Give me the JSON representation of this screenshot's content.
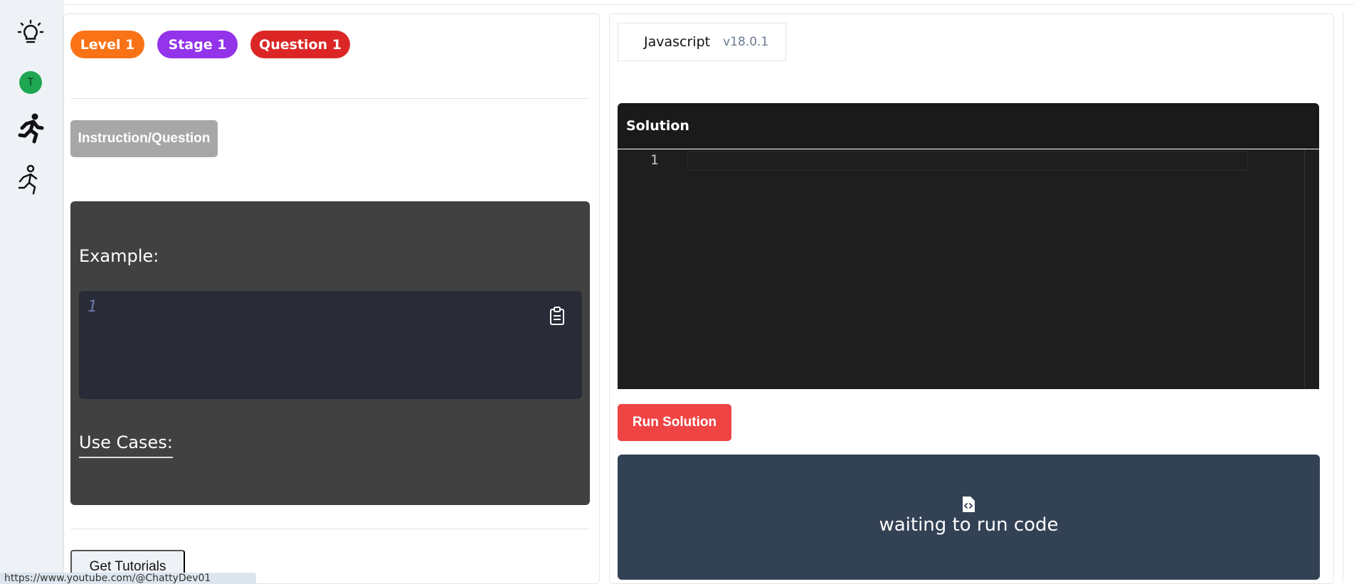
{
  "sidebar": {
    "icons": [
      "lightbulb-icon",
      "avatar",
      "running-person-icon",
      "jogging-person-icon"
    ],
    "avatar_initial": "T",
    "avatar_color": "#1fa653"
  },
  "badges": [
    {
      "label": "Level 1",
      "color": "#f97316"
    },
    {
      "label": "Stage 1",
      "color": "#9333ea"
    },
    {
      "label": "Question 1",
      "color": "#dc2626"
    }
  ],
  "instruction": {
    "button_label": "Instruction/Question"
  },
  "example": {
    "label": "Example:",
    "line_number": "1",
    "copy_icon": "clipboard-icon",
    "use_cases_label": "Use Cases:"
  },
  "tutorials": {
    "button_label": "Get Tutorials"
  },
  "status_bar": {
    "url": "https://www.youtube.com/@ChattyDev01"
  },
  "language": {
    "name": "Javascript",
    "version": "v18.0.1"
  },
  "solution": {
    "header": "Solution",
    "line_number": "1"
  },
  "run": {
    "button_label": "Run Solution",
    "color": "#ef4444"
  },
  "output": {
    "icon": "file-code-icon",
    "message": "waiting to run code"
  }
}
